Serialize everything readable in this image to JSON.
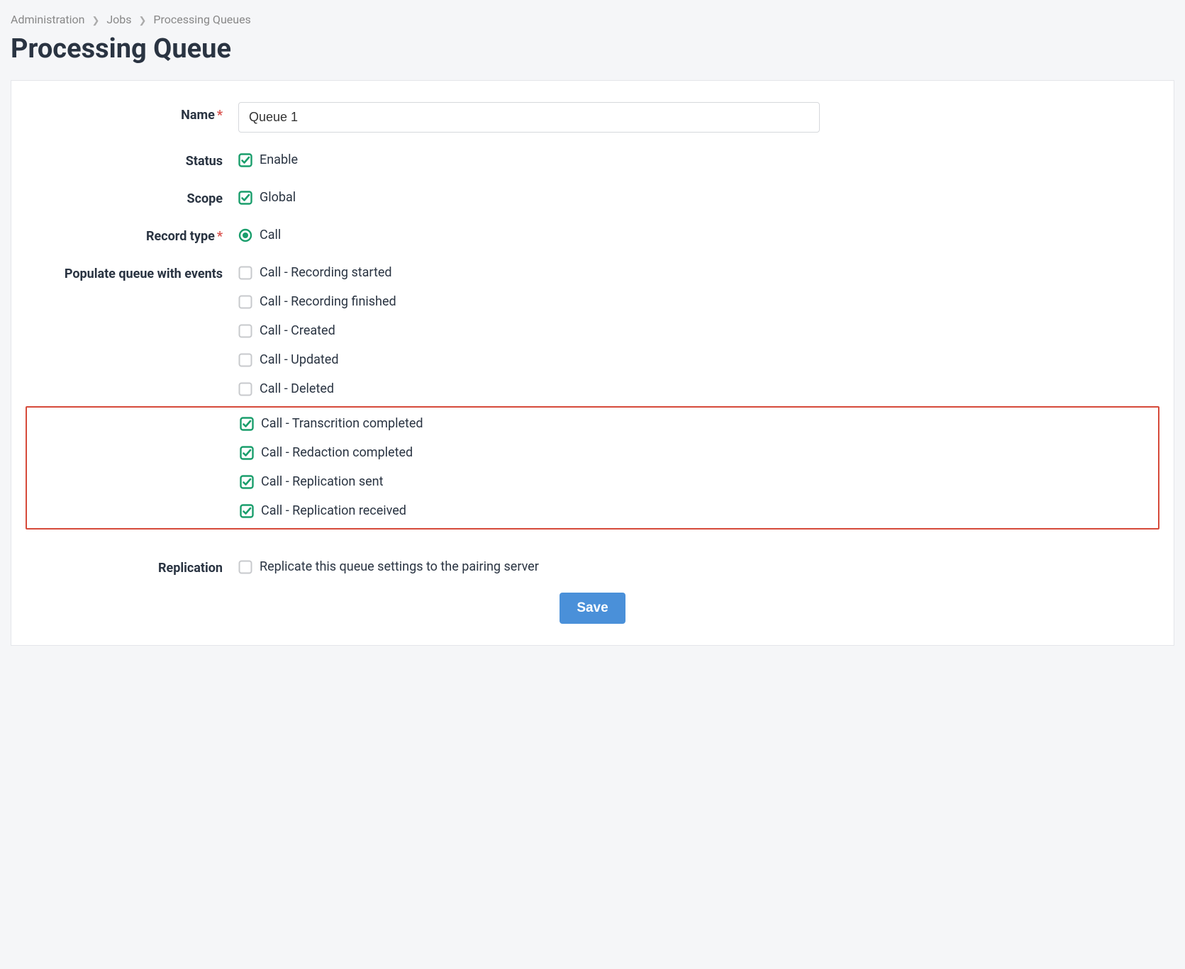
{
  "breadcrumb": {
    "items": [
      "Administration",
      "Jobs",
      "Processing Queues"
    ]
  },
  "page_title": "Processing Queue",
  "form": {
    "name": {
      "label": "Name",
      "required": true,
      "value": "Queue 1"
    },
    "status": {
      "label": "Status",
      "option_label": "Enable",
      "checked": true
    },
    "scope": {
      "label": "Scope",
      "option_label": "Global",
      "checked": true
    },
    "record_type": {
      "label": "Record type",
      "required": true,
      "option_label": "Call",
      "selected": true
    },
    "events": {
      "label": "Populate queue with events",
      "items": [
        {
          "label": "Call - Recording started",
          "checked": false,
          "highlighted": false
        },
        {
          "label": "Call - Recording finished",
          "checked": false,
          "highlighted": false
        },
        {
          "label": "Call - Created",
          "checked": false,
          "highlighted": false
        },
        {
          "label": "Call - Updated",
          "checked": false,
          "highlighted": false
        },
        {
          "label": "Call - Deleted",
          "checked": false,
          "highlighted": false
        },
        {
          "label": "Call - Transcrition completed",
          "checked": true,
          "highlighted": true
        },
        {
          "label": "Call - Redaction completed",
          "checked": true,
          "highlighted": true
        },
        {
          "label": "Call - Replication sent",
          "checked": true,
          "highlighted": true
        },
        {
          "label": "Call - Replication received",
          "checked": true,
          "highlighted": true
        }
      ]
    },
    "replication": {
      "label": "Replication",
      "option_label": "Replicate this queue settings to the pairing server",
      "checked": false
    },
    "save_label": "Save"
  }
}
